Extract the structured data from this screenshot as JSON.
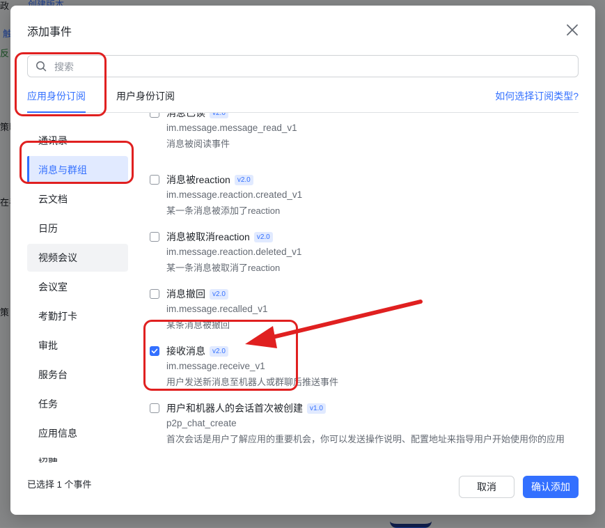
{
  "background": {
    "fragments": [
      "政",
      "创建版本",
      "触",
      "反",
      "策略",
      "在手",
      "策",
      "哈"
    ]
  },
  "modal": {
    "title": "添加事件",
    "close_icon": "close-icon"
  },
  "search": {
    "placeholder": "搜索",
    "value": "",
    "icon": "search-icon"
  },
  "tabs": [
    {
      "label": "应用身份订阅",
      "active": true
    },
    {
      "label": "用户身份订阅",
      "active": false
    }
  ],
  "help_link": "如何选择订阅类型?",
  "sidebar": {
    "items": [
      {
        "label": "通讯录"
      },
      {
        "label": "消息与群组",
        "active": true
      },
      {
        "label": "云文档"
      },
      {
        "label": "日历"
      },
      {
        "label": "视频会议"
      },
      {
        "label": "会议室"
      },
      {
        "label": "考勤打卡"
      },
      {
        "label": "审批"
      },
      {
        "label": "服务台"
      },
      {
        "label": "任务"
      },
      {
        "label": "应用信息"
      },
      {
        "label": "招聘"
      }
    ]
  },
  "events": [
    {
      "name": "消息已读",
      "version": "v2.0",
      "key": "im.message.message_read_v1",
      "desc": "消息被阅读事件",
      "checked": false
    },
    {
      "name": "消息被reaction",
      "version": "v2.0",
      "key": "im.message.reaction.created_v1",
      "desc": "某一条消息被添加了reaction",
      "checked": false
    },
    {
      "name": "消息被取消reaction",
      "version": "v2.0",
      "key": "im.message.reaction.deleted_v1",
      "desc": "某一条消息被取消了reaction",
      "checked": false
    },
    {
      "name": "消息撤回",
      "version": "v2.0",
      "key": "im.message.recalled_v1",
      "desc": "某条消息被撤回",
      "checked": false
    },
    {
      "name": "接收消息",
      "version": "v2.0",
      "key": "im.message.receive_v1",
      "desc": "用户发送新消息至机器人或群聊后推送事件",
      "checked": true
    },
    {
      "name": "用户和机器人的会话首次被创建",
      "version": "v1.0",
      "key": "p2p_chat_create",
      "desc": "首次会话是用户了解应用的重要机会，你可以发送操作说明、配置地址来指导用户开始使用你的应用",
      "checked": false
    }
  ],
  "footer": {
    "status": "已选择 1 个事件",
    "cancel_label": "取消",
    "confirm_label": "确认添加"
  },
  "colors": {
    "accent": "#3370ff",
    "annotation": "#e02020"
  }
}
